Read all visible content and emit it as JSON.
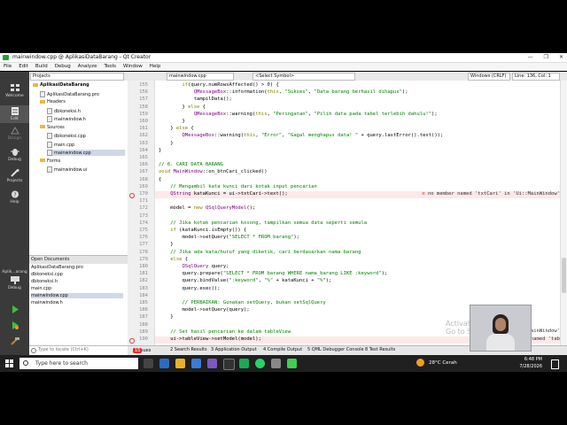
{
  "window": {
    "title": "mainwindow.cpp @ AplikasiDataBarang - Qt Creator",
    "controls": [
      "—",
      "❐",
      "✕"
    ]
  },
  "menu": [
    "File",
    "Edit",
    "Build",
    "Debug",
    "Analyze",
    "Tools",
    "Window",
    "Help"
  ],
  "toolbar": {
    "projects_select": "Projects",
    "file_tab": "mainwindow.cpp",
    "symbol_select": "<Select Symbol>",
    "encoding": "Windows (CRLF)",
    "position": "Line: 136, Col: 1"
  },
  "modes": [
    {
      "label": "Welcome",
      "icon": "grid-icon"
    },
    {
      "label": "Edit",
      "icon": "edit-icon"
    },
    {
      "label": "Design",
      "icon": "design-icon"
    },
    {
      "label": "Debug",
      "icon": "bug-icon"
    },
    {
      "label": "Projects",
      "icon": "wrench-icon"
    },
    {
      "label": "Help",
      "icon": "help-icon"
    }
  ],
  "kit": {
    "label": "Aplik...arang",
    "sub": "Debug"
  },
  "project_tree": [
    {
      "label": "AplikasiDataBarang",
      "type": "project",
      "indent": 0
    },
    {
      "label": "AplikasiDataBarang.pro",
      "type": "file",
      "indent": 1
    },
    {
      "label": "Headers",
      "type": "folder",
      "indent": 1
    },
    {
      "label": "dbkoneksi.h",
      "type": "file",
      "indent": 2
    },
    {
      "label": "mainwindow.h",
      "type": "file",
      "indent": 2
    },
    {
      "label": "Sources",
      "type": "folder",
      "indent": 1
    },
    {
      "label": "dbkoneksi.cpp",
      "type": "file",
      "indent": 2
    },
    {
      "label": "main.cpp",
      "type": "file",
      "indent": 2
    },
    {
      "label": "mainwindow.cpp",
      "type": "file",
      "indent": 2,
      "selected": true
    },
    {
      "label": "Forms",
      "type": "folder",
      "indent": 1
    },
    {
      "label": "mainwindow.ui",
      "type": "file",
      "indent": 2
    }
  ],
  "open_documents": {
    "title": "Open Documents",
    "items": [
      "AplikasiDataBarang.pro",
      "dbkoneksi.cpp",
      "dbkoneksi.h",
      "main.cpp",
      "mainwindow.cpp",
      "mainwindow.h"
    ],
    "selected": "mainwindow.cpp"
  },
  "editor": {
    "lines": [
      {
        "n": "155",
        "text": "        if(query.numRowsAffected() > 0) {"
      },
      {
        "n": "156",
        "text": "            QMessageBox::information(this, \"Sukses\", \"Data barang berhasil dihapus\");"
      },
      {
        "n": "157",
        "text": "            tampilData();"
      },
      {
        "n": "158",
        "text": "        } else {"
      },
      {
        "n": "159",
        "text": "            QMessageBox::warning(this, \"Peringatan\", \"Pilih data pada tabel terlebih dahulu!\");"
      },
      {
        "n": "160",
        "text": "        }"
      },
      {
        "n": "161",
        "text": "    } else {"
      },
      {
        "n": "162",
        "text": "        QMessageBox::warning(this, \"Error\", \"Gagal menghapus data! \" + query.lastError().text());"
      },
      {
        "n": "163",
        "text": "    }"
      },
      {
        "n": "164",
        "text": "}"
      },
      {
        "n": "165",
        "text": ""
      },
      {
        "n": "166",
        "text": "// 6. CARI DATA BARANG"
      },
      {
        "n": "167",
        "text": "void MainWindow::on_btnCari_clicked()"
      },
      {
        "n": "168",
        "text": "{"
      },
      {
        "n": "169",
        "text": "    // Mengambil kata kunci dari kotak input pencarian"
      },
      {
        "n": "170",
        "text": "    QString kataKunci = ui->txtCari->text();",
        "error": "no member named 'txtCari' in 'Ui::MainWindow'"
      },
      {
        "n": "171",
        "text": ""
      },
      {
        "n": "172",
        "text": "    model = new QSqlQueryModel();"
      },
      {
        "n": "173",
        "text": ""
      },
      {
        "n": "174",
        "text": "    // Jika kotak pencarian kosong, tampilkan semua data seperti semula"
      },
      {
        "n": "175",
        "text": "    if (kataKunci.isEmpty()) {"
      },
      {
        "n": "176",
        "text": "        model->setQuery(\"SELECT * FROM barang\");"
      },
      {
        "n": "177",
        "text": "    }"
      },
      {
        "n": "178",
        "text": "    // Jika ada kata/huruf yang diketik, cari berdasarkan nama barang"
      },
      {
        "n": "179",
        "text": "    else {"
      },
      {
        "n": "180",
        "text": "        QSqlQuery query;"
      },
      {
        "n": "181",
        "text": "        query.prepare(\"SELECT * FROM barang WHERE nama_barang LIKE :keyword\");"
      },
      {
        "n": "182",
        "text": "        query.bindValue(\":keyword\", \"%\" + kataKunci + \"%\");"
      },
      {
        "n": "183",
        "text": "        query.exec();"
      },
      {
        "n": "184",
        "text": ""
      },
      {
        "n": "185",
        "text": "        // PERBAIKAN: Gunakan setQuery, bukan setSqlQuery"
      },
      {
        "n": "186",
        "text": "        model->setQuery(query);"
      },
      {
        "n": "187",
        "text": "    }"
      },
      {
        "n": "188",
        "text": ""
      },
      {
        "n": "189",
        "text": "    // Set hasil pencarian ke dalam tableView"
      },
      {
        "n": "190",
        "text": "    ui->tableView->setModel(model);",
        "error": "no member named 'tab"
      }
    ],
    "watermark": [
      "Activate",
      "Go to Se"
    ],
    "overlay_text": "uiMainWindow'"
  },
  "locator": {
    "placeholder": "Type to locate (Ctrl+K)"
  },
  "output_tabs": [
    "1 Issues",
    "2 Search Results",
    "3 Application Output",
    "4 Compile Output",
    "5 QML Debugger Console",
    "8 Test Results"
  ],
  "issues_count": "15",
  "taskbar": {
    "search_placeholder": "Type here to search",
    "weather": "28°C  Cerah",
    "time": "6:48 PM",
    "date": "7/28/2026"
  },
  "colors": {
    "error_bg": "#fde8e8",
    "sidebar": "#3a3a3a",
    "taskbar": "#202020",
    "accent_green": "#2b9a3c"
  }
}
